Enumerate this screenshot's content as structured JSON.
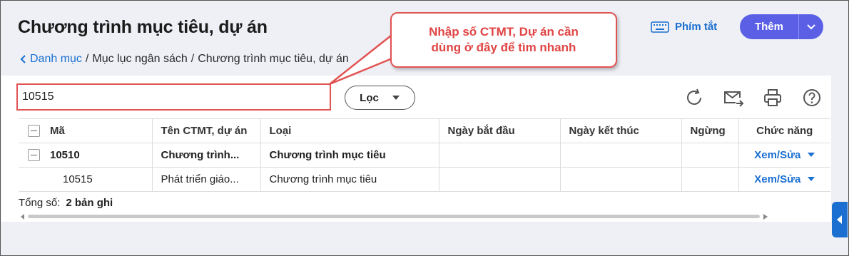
{
  "header": {
    "title": "Chương trình mục tiêu, dự án",
    "breadcrumb": {
      "back": "Danh mục",
      "sep1": "/",
      "item2": "Mục lục ngân sách",
      "sep2": "/",
      "item3": "Chương trình mục tiêu, dự án"
    },
    "shortcut_label": "Phím tắt",
    "add_label": "Thêm"
  },
  "callout": {
    "line1": "Nhập số CTMT, Dự án cần",
    "line2": "dùng ở đây để tìm nhanh"
  },
  "search": {
    "value": "10515"
  },
  "filter": {
    "label": "Lọc"
  },
  "table": {
    "headers": [
      "Mã",
      "Tên CTMT, dự án",
      "Loại",
      "Ngày bắt đầu",
      "Ngày kết thúc",
      "Ngừng",
      "Chức năng"
    ],
    "rows": [
      {
        "code": "10510",
        "name": "Chương trình...",
        "type": "Chương trình mục tiêu",
        "start": "",
        "end": "",
        "stop": "",
        "action": "Xem/Sửa"
      },
      {
        "code": "10515",
        "name": "Phát triển giáo...",
        "type": "Chương trình mục tiêu",
        "start": "",
        "end": "",
        "stop": "",
        "action": "Xem/Sửa"
      }
    ]
  },
  "footer": {
    "total_label": "Tổng số:",
    "total_value": "2 bản ghi"
  },
  "colors": {
    "accent": "#5b5fe6",
    "link": "#1a6fd0",
    "callout": "#e25353"
  }
}
